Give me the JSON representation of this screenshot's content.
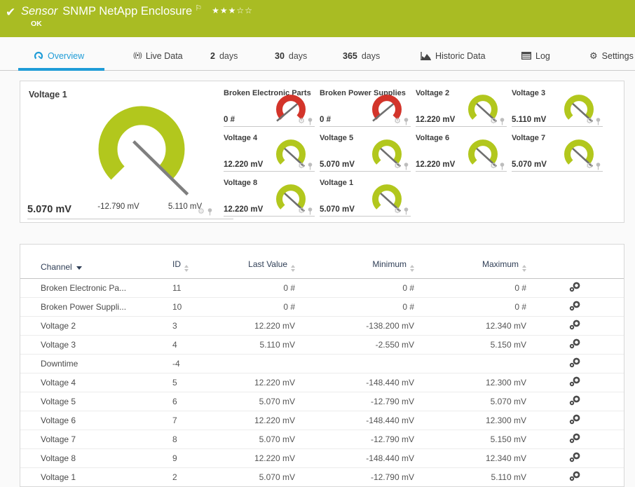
{
  "colors": {
    "header_bar": "#a9bc23",
    "gauge_green": "#b2c71d",
    "gauge_red": "#d3342a",
    "accent_blue": "#1f9cd7"
  },
  "header": {
    "status_icon": "check-icon",
    "kind_label": "Sensor",
    "title": "SNMP NetApp Enclosure",
    "flag_icon": "flag-icon",
    "status_text": "OK",
    "priority": {
      "filled": 3,
      "total": 5
    }
  },
  "tabs": [
    {
      "label": "Overview",
      "icon": "overview-gauge-icon",
      "active": true
    },
    {
      "label": "Live Data",
      "icon": "live-data-icon",
      "active": false
    },
    {
      "label_strong": "2",
      "label": "days",
      "active": false
    },
    {
      "label_strong": "30",
      "label": "days",
      "active": false
    },
    {
      "label_strong": "365",
      "label": "days",
      "active": false
    },
    {
      "label": "Historic Data",
      "icon": "historic-data-icon",
      "active": false
    },
    {
      "label": "Log",
      "icon": "log-icon",
      "active": false
    },
    {
      "label": "Settings",
      "icon": "settings-icon",
      "active": false
    }
  ],
  "gauges": {
    "primary": {
      "title": "Voltage 1",
      "value": "5.070 mV",
      "scale_min": "-12.790 mV",
      "scale_max": "5.110 mV",
      "color": "#b2c71d",
      "needle": 0.998
    },
    "tiles": [
      {
        "title": "Broken Electronic Parts",
        "value": "0 #",
        "color": "#d3342a",
        "needle": 0.02
      },
      {
        "title": "Broken Power Supplies",
        "value": "0 #",
        "color": "#d3342a",
        "needle": 0.02
      },
      {
        "title": "Voltage 2",
        "value": "12.220 mV",
        "color": "#b2c71d",
        "needle": 0.99
      },
      {
        "title": "Voltage 3",
        "value": "5.110 mV",
        "color": "#b2c71d",
        "needle": 0.99
      },
      {
        "title": "Voltage 4",
        "value": "12.220 mV",
        "color": "#b2c71d",
        "needle": 0.99
      },
      {
        "title": "Voltage 5",
        "value": "5.070 mV",
        "color": "#b2c71d",
        "needle": 0.99
      },
      {
        "title": "Voltage 6",
        "value": "12.220 mV",
        "color": "#b2c71d",
        "needle": 0.99
      },
      {
        "title": "Voltage 7",
        "value": "5.070 mV",
        "color": "#b2c71d",
        "needle": 0.99
      },
      {
        "title": "Voltage 8",
        "value": "12.220 mV",
        "color": "#b2c71d",
        "needle": 0.99
      },
      {
        "title": "Voltage 1",
        "value": "5.070 mV",
        "color": "#b2c71d",
        "needle": 0.99
      }
    ],
    "tile_action_icons": [
      "settings-gear-icon",
      "pin-icon"
    ]
  },
  "table": {
    "columns": [
      {
        "label": "Channel",
        "sort": "desc",
        "align": "left"
      },
      {
        "label": "ID",
        "sort": "both",
        "align": "left"
      },
      {
        "label": "Last Value",
        "sort": "both",
        "align": "right"
      },
      {
        "label": "Minimum",
        "sort": "both",
        "align": "right"
      },
      {
        "label": "Maximum",
        "sort": "both",
        "align": "right"
      },
      {
        "label": "",
        "sort": "none",
        "align": "center",
        "icon": "channel-settings-icon"
      }
    ],
    "rows": [
      {
        "channel": "Broken Electronic Pa...",
        "id": "11",
        "last": "0 #",
        "min": "0 #",
        "max": "0 #"
      },
      {
        "channel": "Broken Power Suppli...",
        "id": "10",
        "last": "0 #",
        "min": "0 #",
        "max": "0 #"
      },
      {
        "channel": "Voltage 2",
        "id": "3",
        "last": "12.220 mV",
        "min": "-138.200 mV",
        "max": "12.340 mV"
      },
      {
        "channel": "Voltage 3",
        "id": "4",
        "last": "5.110 mV",
        "min": "-2.550 mV",
        "max": "5.150 mV"
      },
      {
        "channel": "Downtime",
        "id": "-4",
        "last": "",
        "min": "",
        "max": ""
      },
      {
        "channel": "Voltage 4",
        "id": "5",
        "last": "12.220 mV",
        "min": "-148.440 mV",
        "max": "12.300 mV"
      },
      {
        "channel": "Voltage 5",
        "id": "6",
        "last": "5.070 mV",
        "min": "-12.790 mV",
        "max": "5.070 mV"
      },
      {
        "channel": "Voltage 6",
        "id": "7",
        "last": "12.220 mV",
        "min": "-148.440 mV",
        "max": "12.300 mV"
      },
      {
        "channel": "Voltage 7",
        "id": "8",
        "last": "5.070 mV",
        "min": "-12.790 mV",
        "max": "5.150 mV"
      },
      {
        "channel": "Voltage 8",
        "id": "9",
        "last": "12.220 mV",
        "min": "-148.440 mV",
        "max": "12.340 mV"
      },
      {
        "channel": "Voltage 1",
        "id": "2",
        "last": "5.070 mV",
        "min": "-12.790 mV",
        "max": "5.110 mV"
      }
    ]
  }
}
